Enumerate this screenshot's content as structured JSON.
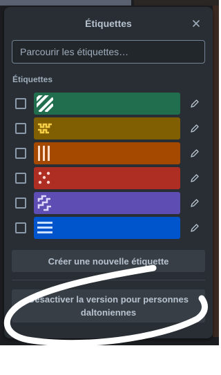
{
  "panel": {
    "title": "Étiquettes",
    "search_placeholder": "Parcourir les étiquettes…",
    "section_label": "Étiquettes",
    "labels": [
      {
        "color": "#216e4e",
        "pattern": "diagonal-stripes",
        "checked": false
      },
      {
        "color": "#7f5f01",
        "pattern": "zigzag",
        "checked": false
      },
      {
        "color": "#a54800",
        "pattern": "vertical-bars",
        "checked": false
      },
      {
        "color": "#ae2e24",
        "pattern": "dots",
        "checked": false
      },
      {
        "color": "#5e4db2",
        "pattern": "steps",
        "checked": false
      },
      {
        "color": "#0055cc",
        "pattern": "horizontal-lines",
        "checked": false
      }
    ],
    "create_button": "Créer une nouvelle étiquette",
    "colorblind_button_line1": "Désactiver la version pour personnes",
    "colorblind_button_line2": "daltoniennes"
  },
  "icons": {
    "close": "close-icon",
    "edit": "pencil-icon"
  },
  "colors": {
    "panel_bg": "#282e33",
    "text": "#b6c2cf",
    "button_bg": "#383e45"
  }
}
